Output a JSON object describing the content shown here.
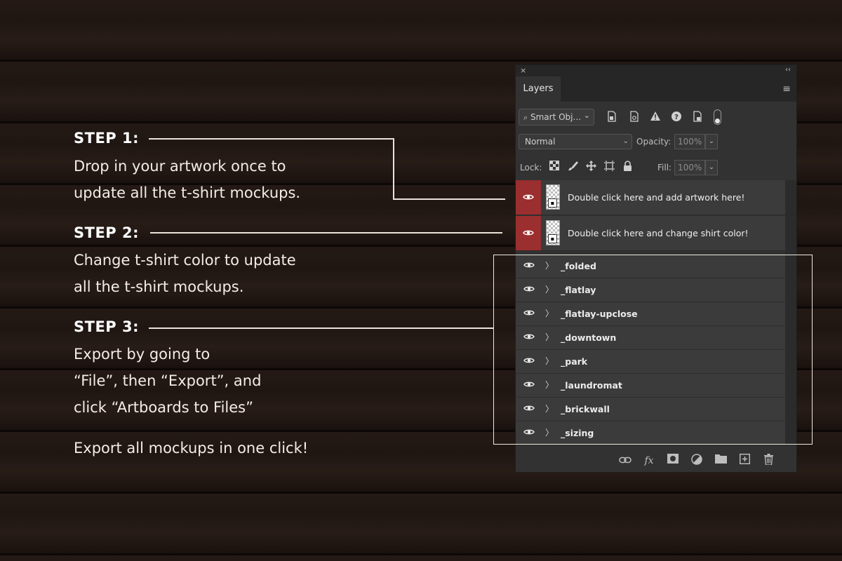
{
  "steps": [
    {
      "title": "STEP 1:",
      "text": "Drop in your artwork once to\nupdate all the t-shirt mockups."
    },
    {
      "title": "STEP 2:",
      "text": "Change t-shirt color to update\nall the t-shirt mockups."
    },
    {
      "title": "STEP 3:",
      "text": "Export by going to\n“File”, then “Export”, and\nclick “Artboards to Files”"
    }
  ],
  "footer_note": "Export all mockups in one click!",
  "panel": {
    "close_glyph": "×",
    "collapse_glyph": "‹‹",
    "tab_label": "Layers",
    "menu_glyph": "≡",
    "filter": {
      "search_placeholder": "Smart Obj...",
      "search_arrow": "⌄",
      "icons": [
        "new-smart-object-filter-icon",
        "linked-filter-icon",
        "warning-icon",
        "help-icon",
        "file-icon"
      ]
    },
    "blend_mode": "Normal",
    "opacity_label": "Opacity:",
    "opacity_value": "100%",
    "lock_label": "Lock:",
    "fill_label": "Fill:",
    "fill_value": "100%",
    "smart_layers": [
      {
        "name": "Double click here and add artwork here!"
      },
      {
        "name": "Double click here and change shirt color!"
      }
    ],
    "groups": [
      {
        "name": "_folded"
      },
      {
        "name": "_flatlay"
      },
      {
        "name": "_flatlay-upclose"
      },
      {
        "name": "_downtown"
      },
      {
        "name": "_park"
      },
      {
        "name": "_laundromat"
      },
      {
        "name": "_brickwall"
      },
      {
        "name": "_sizing"
      }
    ],
    "bottom_icons": [
      "link-icon",
      "fx-icon",
      "mask-icon",
      "adjustment-icon",
      "folder-icon",
      "new-layer-icon",
      "trash-icon"
    ],
    "colors": {
      "accent_eye": "#9b2e2e",
      "panel_bg": "#323232"
    }
  }
}
